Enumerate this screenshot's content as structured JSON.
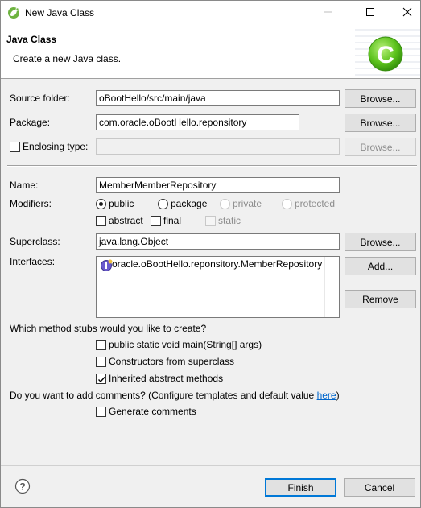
{
  "window": {
    "title": "New Java Class",
    "controls": {
      "minimize": "minimize-icon",
      "maximize": "maximize-icon",
      "close": "close-icon"
    }
  },
  "banner": {
    "title": "Java Class",
    "description": "Create a new Java class.",
    "logo": "new-class-wizard-icon"
  },
  "form": {
    "source_folder": {
      "label": "Source folder:",
      "value": "oBootHello/src/main/java",
      "button": "Browse..."
    },
    "package": {
      "label": "Package:",
      "value": "com.oracle.oBootHello.reponsitory",
      "button": "Browse..."
    },
    "enclosing_type": {
      "label": "Enclosing type:",
      "value": "",
      "button": "Browse...",
      "checked": false
    },
    "name": {
      "label": "Name:",
      "value": "MemberMemberRepository"
    },
    "modifiers": {
      "label": "Modifiers:",
      "public": "public",
      "package": "package",
      "private": "private",
      "protected": "protected",
      "abstract": "abstract",
      "final": "final",
      "static": "static",
      "selected": "public"
    },
    "superclass": {
      "label": "Superclass:",
      "value": "java.lang.Object",
      "button": "Browse..."
    },
    "interfaces": {
      "label": "Interfaces:",
      "items": [
        "oracle.oBootHello.reponsitory.MemberRepository"
      ],
      "add_button": "Add...",
      "remove_button": "Remove"
    },
    "stubs": {
      "question": "Which method stubs would you like to create?",
      "main": {
        "label": "public static void main(String[] args)",
        "checked": false
      },
      "constructors": {
        "label": "Constructors from superclass",
        "checked": false
      },
      "inherited": {
        "label": "Inherited abstract methods",
        "checked": true
      }
    },
    "comments": {
      "question": "Do you want to add comments? (Configure templates and default value ",
      "link": "here",
      "question_end": ")",
      "generate": {
        "label": "Generate comments",
        "checked": false
      }
    }
  },
  "footer": {
    "finish": "Finish",
    "cancel": "Cancel",
    "help_icon": "help-icon"
  },
  "colors": {
    "accent": "#0078d7",
    "link": "#0066cc",
    "logo_green": "#6cc644"
  }
}
